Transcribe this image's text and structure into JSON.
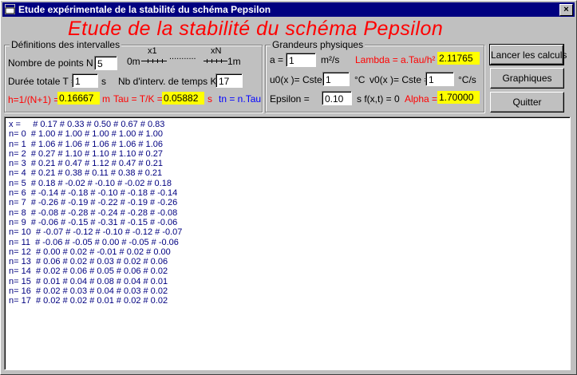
{
  "window": {
    "title": "Etude expérimentale de la stabilité du schéma Pepsilon",
    "close_glyph": "×"
  },
  "banner": "Etude de la stabilité du schéma Pepsilon",
  "intervals": {
    "legend": "Définitions des intervalles",
    "points_label": "Nombre de points  N =",
    "points_value": "5",
    "slider_x1": "x1",
    "slider_xN": "xN",
    "slider_left": "0m",
    "slider_right": "1m",
    "slider_dots": "...........",
    "duration_label": "Durée totale T =",
    "duration_value": "1",
    "duration_unit": "s",
    "time_intervals_label": "Nb d'interv. de temps K =",
    "time_intervals_value": "17",
    "h_label": "h=1/(N+1) =",
    "h_value": "0.16667",
    "h_unit": "m",
    "tau_label": "Tau = T/K =",
    "tau_value": "0.05882",
    "tau_unit": "s",
    "tn_label": "tn = n.Tau"
  },
  "physics": {
    "legend": "Grandeurs physiques",
    "a_label": "a =",
    "a_value": "1",
    "a_unit": "m²/s",
    "lambda_label": "Lambda = a.Tau/h² =",
    "lambda_value": "2.11765",
    "u0_label": "u0(x )= Cste =",
    "u0_value": "1",
    "u0_unit": "°C",
    "v0_label": "v0(x )= Cste =",
    "v0_value": "1",
    "v0_unit": "°C/s",
    "epsilon_label": "Epsilon =",
    "epsilon_value": "0.10",
    "f_label": "s   f(x,t) = 0",
    "alpha_label": "Alpha =",
    "alpha_value": "1.70000"
  },
  "buttons": {
    "compute": "Lancer les calculs",
    "graphs": "Graphiques",
    "quit": "Quitter"
  },
  "output_lines": [
    "x =     # 0.17 # 0.33 # 0.50 # 0.67 # 0.83",
    "n= 0  # 1.00 # 1.00 # 1.00 # 1.00 # 1.00",
    "n= 1  # 1.06 # 1.06 # 1.06 # 1.06 # 1.06",
    "n= 2  # 0.27 # 1.10 # 1.10 # 1.10 # 0.27",
    "n= 3  # 0.21 # 0.47 # 1.12 # 0.47 # 0.21",
    "n= 4  # 0.21 # 0.38 # 0.11 # 0.38 # 0.21",
    "n= 5  # 0.18 # -0.02 # -0.10 # -0.02 # 0.18",
    "n= 6  # -0.14 # -0.18 # -0.10 # -0.18 # -0.14",
    "n= 7  # -0.26 # -0.19 # -0.22 # -0.19 # -0.26",
    "n= 8  # -0.08 # -0.28 # -0.24 # -0.28 # -0.08",
    "n= 9  # -0.06 # -0.15 # -0.31 # -0.15 # -0.06",
    "n= 10  # -0.07 # -0.12 # -0.10 # -0.12 # -0.07",
    "n= 11  # -0.06 # -0.05 # 0.00 # -0.05 # -0.06",
    "n= 12  # 0.00 # 0.02 # -0.01 # 0.02 # 0.00",
    "n= 13  # 0.06 # 0.02 # 0.03 # 0.02 # 0.06",
    "n= 14  # 0.02 # 0.06 # 0.05 # 0.06 # 0.02",
    "n= 15  # 0.01 # 0.04 # 0.08 # 0.04 # 0.01",
    "n= 16  # 0.02 # 0.03 # 0.04 # 0.03 # 0.02",
    "n= 17  # 0.02 # 0.02 # 0.01 # 0.02 # 0.02"
  ]
}
